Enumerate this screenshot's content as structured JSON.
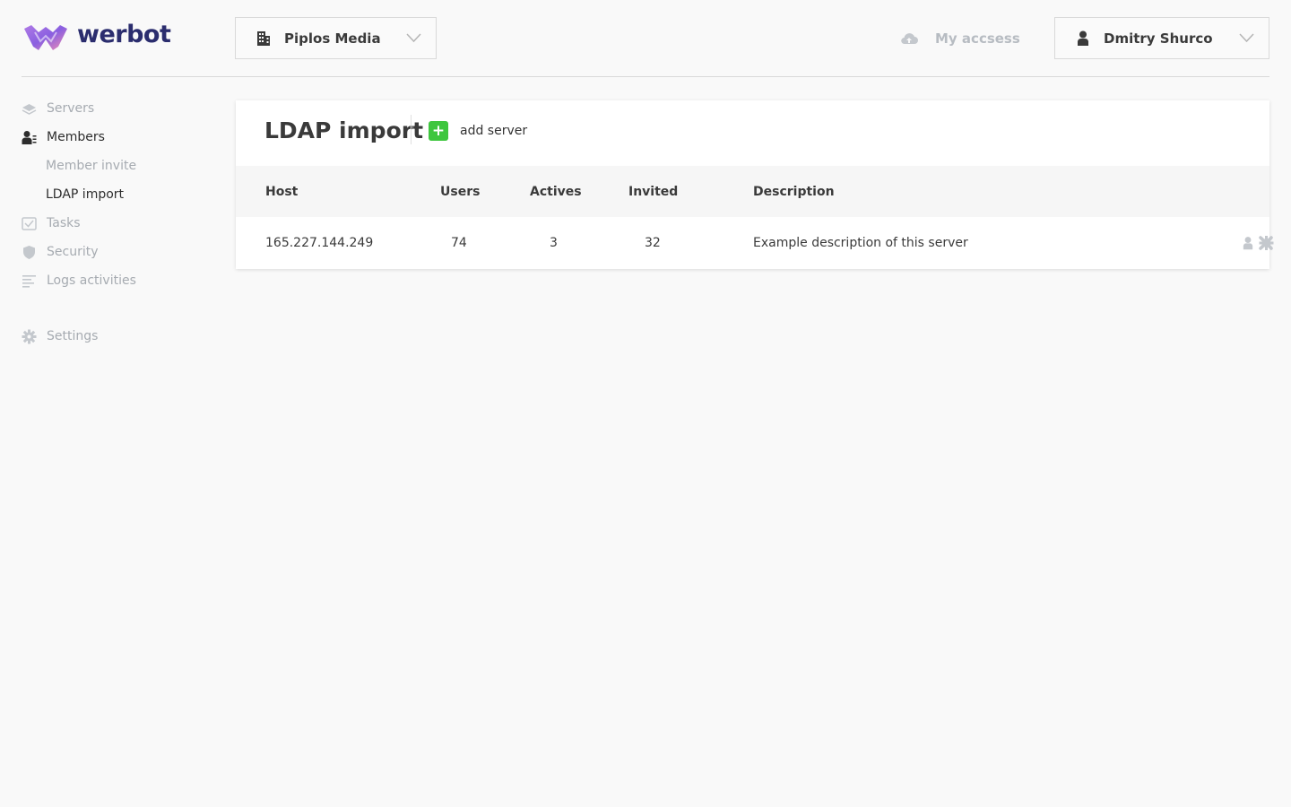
{
  "brand": {
    "name": "werbot"
  },
  "header": {
    "org_name": "Piplos Media",
    "my_access_label": "My accsess",
    "user_name": "Dmitry Shurco"
  },
  "sidebar": {
    "items": [
      {
        "label": "Servers",
        "icon": "layers-icon"
      },
      {
        "label": "Members",
        "icon": "members-icon",
        "active": true
      },
      {
        "label": "Member invite",
        "sub": true
      },
      {
        "label": "LDAP import",
        "sub": true,
        "active": true
      },
      {
        "label": "Tasks",
        "icon": "tasks-icon"
      },
      {
        "label": "Security",
        "icon": "shield-icon"
      },
      {
        "label": "Logs activities",
        "icon": "logs-icon"
      },
      {
        "label": "Settings",
        "icon": "gear-icon"
      }
    ]
  },
  "main": {
    "title": "LDAP import",
    "add_label": "add server",
    "columns": {
      "host": "Host",
      "users": "Users",
      "actives": "Actives",
      "invited": "Invited",
      "description": "Description"
    },
    "rows": [
      {
        "host": "165.227.144.249",
        "users": "74",
        "actives": "3",
        "invited": "32",
        "description": "Example description of this server"
      }
    ]
  },
  "colors": {
    "accent_green": "#3ec63e",
    "brand_navy": "#2b2d6e",
    "muted": "#a6abb1"
  }
}
